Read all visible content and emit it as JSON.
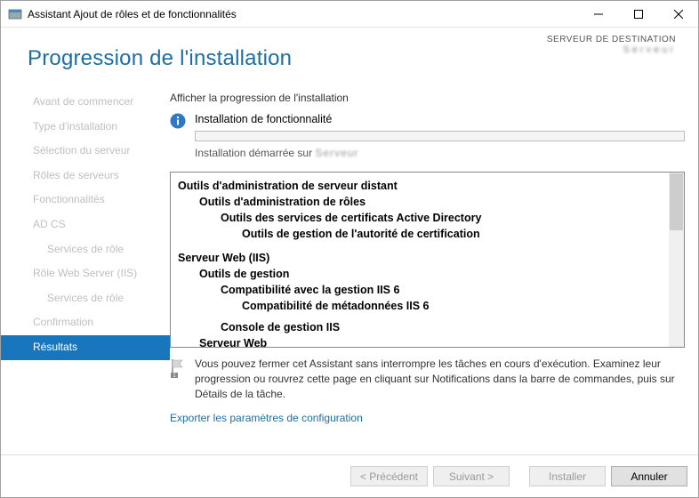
{
  "window": {
    "title": "Assistant Ajout de rôles et de fonctionnalités"
  },
  "header": {
    "title": "Progression de l'installation",
    "destination_label": "SERVEUR DE DESTINATION",
    "destination_server": "Serveur"
  },
  "sidebar": {
    "items": [
      {
        "label": "Avant de commencer",
        "sub": false,
        "active": false
      },
      {
        "label": "Type d'installation",
        "sub": false,
        "active": false
      },
      {
        "label": "Sélection du serveur",
        "sub": false,
        "active": false
      },
      {
        "label": "Rôles de serveurs",
        "sub": false,
        "active": false
      },
      {
        "label": "Fonctionnalités",
        "sub": false,
        "active": false
      },
      {
        "label": "AD CS",
        "sub": false,
        "active": false
      },
      {
        "label": "Services de rôle",
        "sub": true,
        "active": false
      },
      {
        "label": "Rôle Web Server (IIS)",
        "sub": false,
        "active": false
      },
      {
        "label": "Services de rôle",
        "sub": true,
        "active": false
      },
      {
        "label": "Confirmation",
        "sub": false,
        "active": false
      },
      {
        "label": "Résultats",
        "sub": false,
        "active": true
      }
    ]
  },
  "content": {
    "caption": "Afficher la progression de l'installation",
    "status_title": "Installation de fonctionnalité",
    "status_sub_prefix": "Installation démarrée sur ",
    "status_sub_server": "Serveur",
    "tree": [
      {
        "text": "Outils d'administration de serveur distant",
        "indent": 0,
        "bold": true
      },
      {
        "text": "Outils d'administration de rôles",
        "indent": 1,
        "bold": true
      },
      {
        "text": "Outils des services de certificats Active Directory",
        "indent": 2,
        "bold": true
      },
      {
        "text": "Outils de gestion de l'autorité de certification",
        "indent": 3,
        "bold": true
      },
      {
        "text": "Serveur Web (IIS)",
        "indent": 0,
        "bold": true
      },
      {
        "text": "Outils de gestion",
        "indent": 1,
        "bold": true
      },
      {
        "text": "Compatibilité avec la gestion IIS 6",
        "indent": 2,
        "bold": true
      },
      {
        "text": "Compatibilité de métadonnées IIS 6",
        "indent": 3,
        "bold": true
      },
      {
        "text": "Console de gestion IIS",
        "indent": 2,
        "bold": true
      },
      {
        "text": "Serveur Web",
        "indent": 1,
        "bold": true
      }
    ],
    "note": "Vous pouvez fermer cet Assistant sans interrompre les tâches en cours d'exécution. Examinez leur progression ou rouvrez cette page en cliquant sur Notifications dans la barre de commandes, puis sur Détails de la tâche.",
    "export_link": "Exporter les paramètres de configuration"
  },
  "footer": {
    "previous": "< Précédent",
    "next": "Suivant >",
    "install": "Installer",
    "cancel": "Annuler"
  }
}
